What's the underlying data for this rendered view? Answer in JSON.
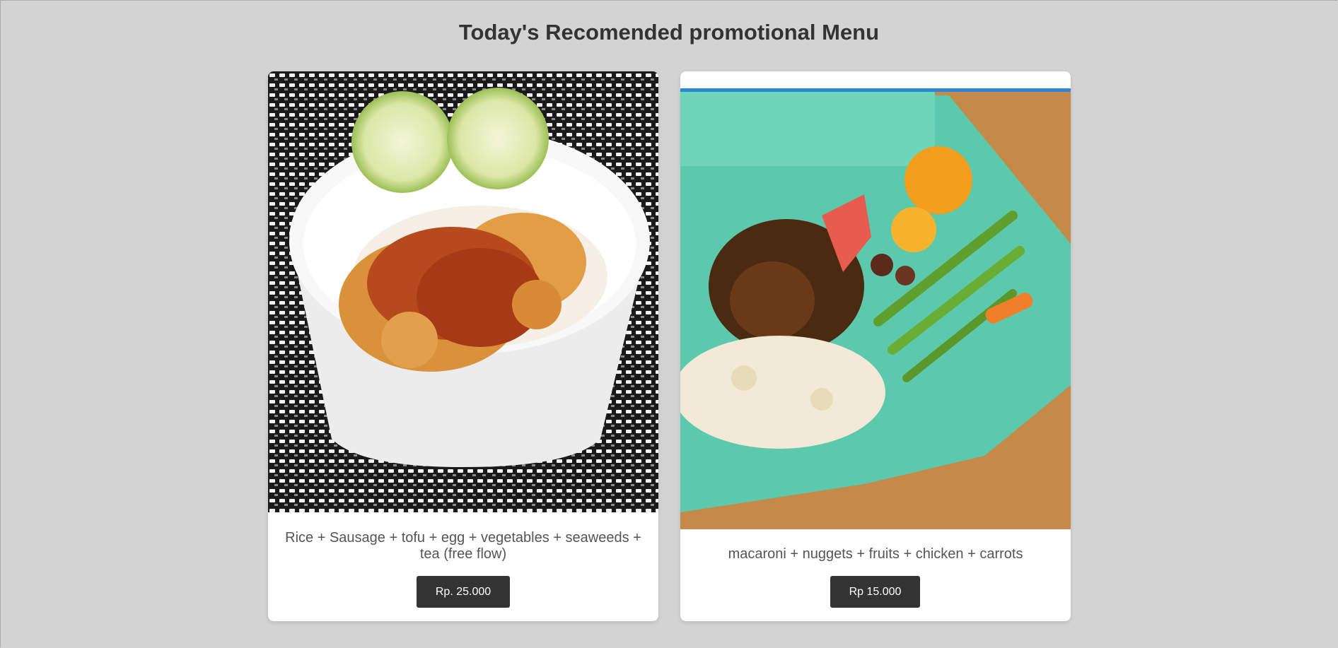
{
  "page": {
    "title": "Today's Recomended promotional Menu"
  },
  "menu": [
    {
      "description": "Rice + Sausage + tofu + egg + vegetables + seaweeds + tea (free flow)",
      "price": "Rp. 25.000"
    },
    {
      "description": "macaroni + nuggets + fruits + chicken + carrots",
      "price": "Rp 15.000"
    }
  ],
  "colors": {
    "background": "#d3d3d3",
    "card": "#ffffff",
    "button": "#333333",
    "title": "#333333",
    "text": "#555555"
  }
}
